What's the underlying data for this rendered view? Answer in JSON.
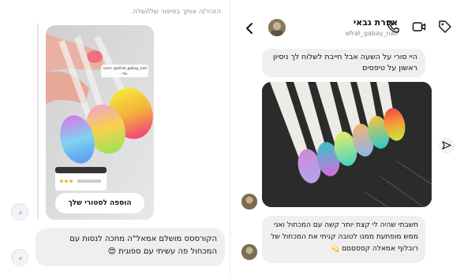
{
  "left_panel": {
    "mention_text": "הזכיר/ה אותך בסיפור שלו/שלה",
    "story": {
      "sticker_text": "efrat_gabay_nail@ הזמנה שלי",
      "add_to_story_label": "הוספה לסטורי שלך"
    },
    "message": {
      "text": "הקורססס מושלם אמאל\"ה מחכה לנסות עם המכחול פה עשיתי עם ספוגית 😍"
    }
  },
  "conversation": {
    "contact_name": "אפרת גבאי",
    "contact_username": "efrat_gabay_nail",
    "messages": [
      {
        "text": "היי סורי על השעה אבל חייבת לשלוח לך ניסיון ראשון על טיפסים"
      },
      {
        "text": "חשבתי שהיה לי קצת יותר קשה עם המכחול ואני ממש מופתעת ממנו לטובה קניתי את המכחול של רובלוף אמאלה קססםםם 💫"
      }
    ]
  },
  "colors": {
    "bubble": "#efefef",
    "muted_text": "#8e8e8e"
  }
}
